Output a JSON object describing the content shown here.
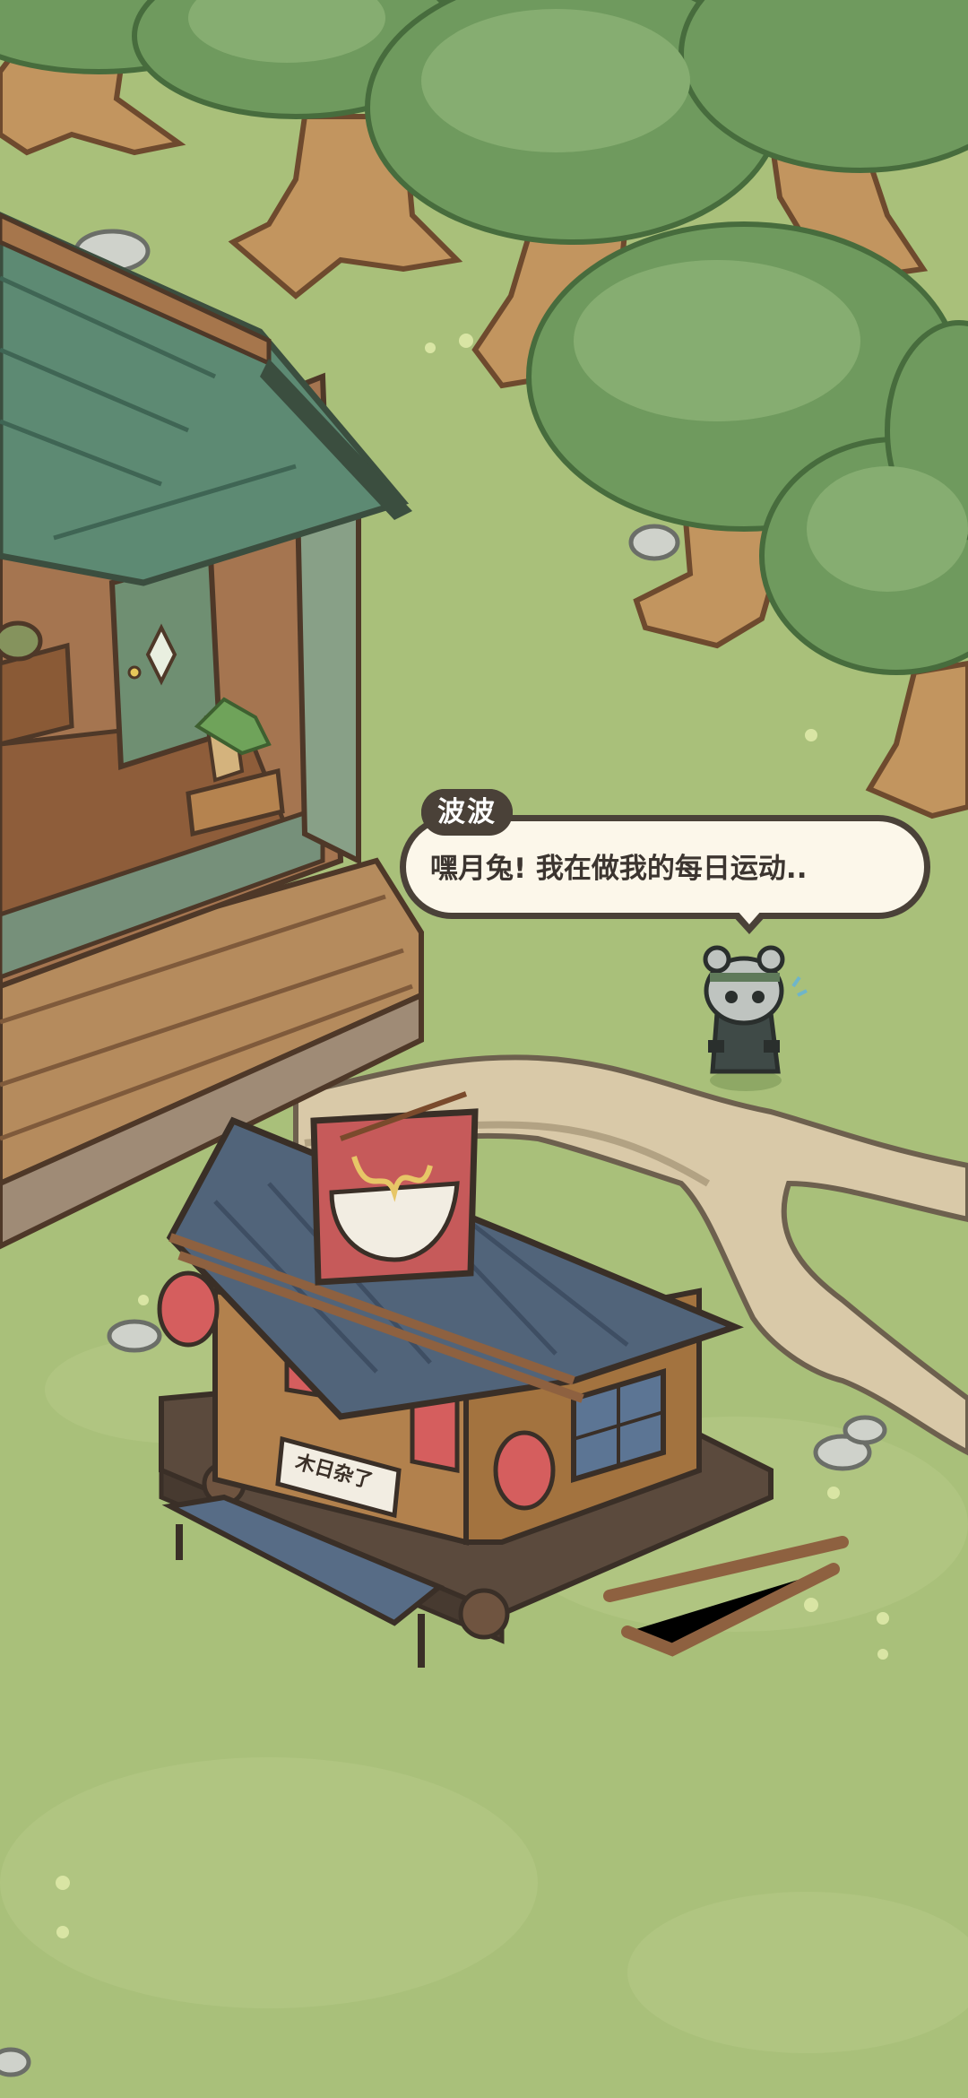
{
  "dialog": {
    "speaker": "波波",
    "text": "嘿月兔! 我在做我的每日运动.."
  },
  "scene": {
    "shop_sign": "木日杂了"
  },
  "colors": {
    "grass": "#a9c07a",
    "grass_light": "#b7cc86",
    "tree_leaves": "#6f9a5e",
    "trunk": "#c2955f",
    "roof_green": "#5d8a73",
    "roof_blue": "#51647a",
    "wood": "#9c6b43",
    "bubble_bg": "#fcf7ea",
    "bubble_border": "#4a4138"
  }
}
